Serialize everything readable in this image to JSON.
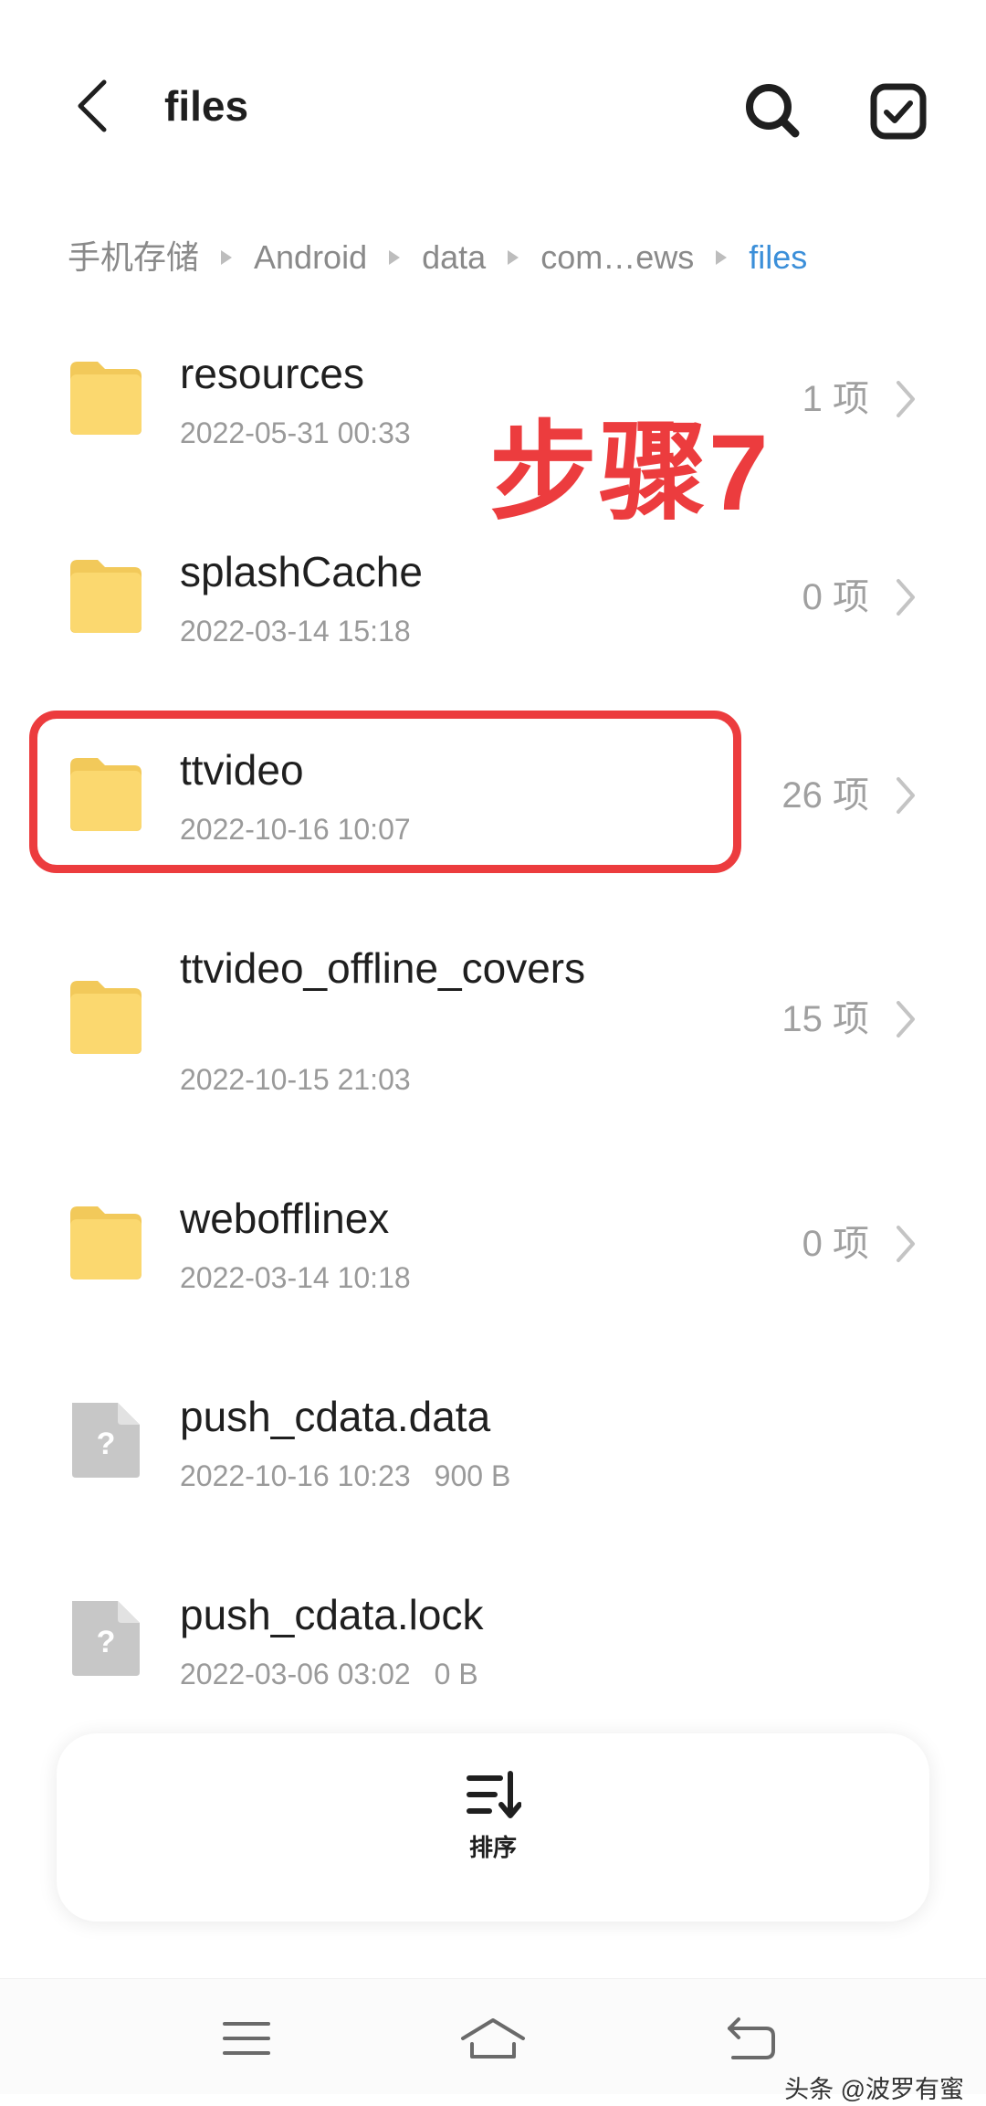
{
  "header": {
    "title": "files"
  },
  "breadcrumb": [
    "手机存储",
    "Android",
    "data",
    "com…ews",
    "files"
  ],
  "items": [
    {
      "name": "resources",
      "date": "2022-05-31 00:33",
      "count": "1 项",
      "type": "folder"
    },
    {
      "name": "splashCache",
      "date": "2022-03-14 15:18",
      "count": "0 项",
      "type": "folder"
    },
    {
      "name": "ttvideo",
      "date": "2022-10-16 10:07",
      "count": "26 项",
      "type": "folder"
    },
    {
      "name": "ttvideo_offline_covers",
      "date": "2022-10-15 21:03",
      "count": "15 项",
      "type": "folder"
    },
    {
      "name": "webofflinex",
      "date": "2022-03-14 10:18",
      "count": "0 项",
      "type": "folder"
    },
    {
      "name": "push_cdata.data",
      "date": "2022-10-16 10:23",
      "size": "900 B",
      "type": "file"
    },
    {
      "name": "push_cdata.lock",
      "date": "2022-03-06 03:02",
      "size": "0 B",
      "type": "file"
    }
  ],
  "annotation": {
    "label": "步骤7",
    "color": "#ec3c3e"
  },
  "toolbar": {
    "sort_label": "排序"
  },
  "watermark": "头条 @波罗有蜜",
  "colors": {
    "folder": "#fbd86f",
    "folder_tab": "#f2c95a",
    "file_icon": "#c7c7c7",
    "breadcrumb_active": "#3b8fd9"
  },
  "icons": {
    "back": "chevron-left-icon",
    "search": "search-icon",
    "select": "checkbox-icon",
    "sort": "sort-icon",
    "nav_menu": "menu-icon",
    "nav_home": "home-icon",
    "nav_back": "back-icon"
  }
}
